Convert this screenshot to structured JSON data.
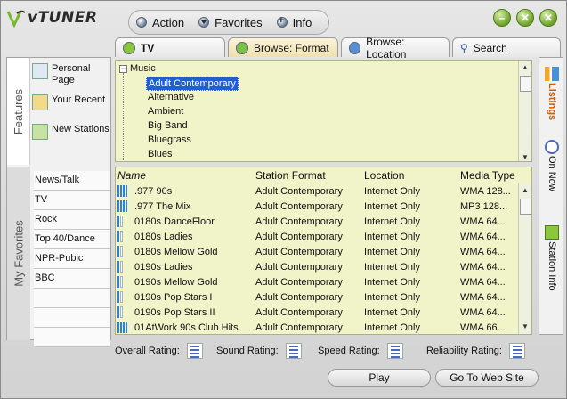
{
  "brand": {
    "logo_text": "vTUNER"
  },
  "menu": {
    "action": "Action",
    "favorites": "Favorites",
    "info": "Info"
  },
  "window_buttons": {
    "minimize": "–",
    "restore": "✕",
    "close": "✕"
  },
  "tabs": [
    {
      "label": "TV",
      "active": false
    },
    {
      "label": "Browse: Format",
      "active": true
    },
    {
      "label": "Browse: Location",
      "active": false
    },
    {
      "label": "Search",
      "active": false
    }
  ],
  "left_tabs": {
    "features": "Features",
    "my_favorites": "My Favorites"
  },
  "features": [
    {
      "label": "Personal Page",
      "icon": "personal-page-icon"
    },
    {
      "label": "Your Recent",
      "icon": "recent-icon"
    },
    {
      "label": "New Stations",
      "icon": "new-stations-icon"
    }
  ],
  "favorites": [
    "News/Talk",
    "TV",
    "Rock",
    "Top 40/Dance",
    "NPR-Pubic",
    "BBC"
  ],
  "tree": {
    "root": "Music",
    "items": [
      "Adult Contemporary",
      "Alternative",
      "Ambient",
      "Big Band",
      "Bluegrass",
      "Blues"
    ],
    "selected": "Adult Contemporary"
  },
  "listing": {
    "columns": [
      "Name",
      "Station Format",
      "Location",
      "Media Type"
    ],
    "rows": [
      {
        "name": ".977 90s",
        "format": "Adult Contemporary",
        "location": "Internet Only",
        "media": "WMA 128..."
      },
      {
        "name": ".977 The Mix",
        "format": "Adult Contemporary",
        "location": "Internet Only",
        "media": "MP3 128..."
      },
      {
        "name": "0180s DanceFloor",
        "format": "Adult Contemporary",
        "location": "Internet Only",
        "media": "WMA 64..."
      },
      {
        "name": "0180s Ladies",
        "format": "Adult Contemporary",
        "location": "Internet Only",
        "media": "WMA 64..."
      },
      {
        "name": "0180s Mellow Gold",
        "format": "Adult Contemporary",
        "location": "Internet Only",
        "media": "WMA 64..."
      },
      {
        "name": "0190s Ladies",
        "format": "Adult Contemporary",
        "location": "Internet Only",
        "media": "WMA 64..."
      },
      {
        "name": "0190s Mellow Gold",
        "format": "Adult Contemporary",
        "location": "Internet Only",
        "media": "WMA 64..."
      },
      {
        "name": "0190s Pop Stars I",
        "format": "Adult Contemporary",
        "location": "Internet Only",
        "media": "WMA 64..."
      },
      {
        "name": "0190s Pop Stars II",
        "format": "Adult Contemporary",
        "location": "Internet Only",
        "media": "WMA 64..."
      },
      {
        "name": "01AtWork 90s Club Hits",
        "format": "Adult Contemporary",
        "location": "Internet Only",
        "media": "WMA 66..."
      }
    ]
  },
  "ratings": [
    "Overall Rating:",
    "Sound Rating:",
    "Speed Rating:",
    "Reliability Rating:"
  ],
  "right_tabs": [
    "Listings",
    "On Now",
    "Station Info"
  ],
  "buttons": {
    "play": "Play",
    "go_to_web_site": "Go To Web Site"
  },
  "colors": {
    "panel_bg": "#f0f4c8",
    "selection": "#1e60d2",
    "accent_green": "#6ea22a",
    "listings_tab": "#d45a00"
  }
}
